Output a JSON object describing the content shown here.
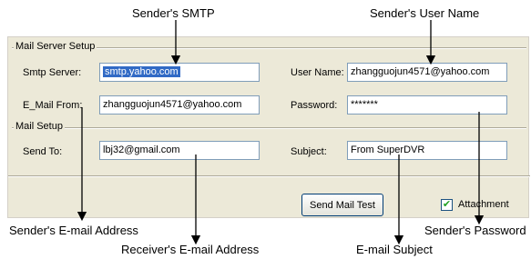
{
  "annotations": {
    "sender_smtp": "Sender's SMTP",
    "sender_user_name": "Sender's User Name",
    "sender_email_address": "Sender's E-mail Address",
    "receiver_email_address": "Receiver's E-mail  Address",
    "email_subject": "E-mail Subject",
    "sender_password": "Sender's Password"
  },
  "mail_server_setup": {
    "title": "Mail Server Setup",
    "smtp_server_label": "Smtp Server:",
    "smtp_server_value": "smtp.yahoo.com",
    "user_name_label": "User Name:",
    "user_name_value": "zhangguojun4571@yahoo.com",
    "email_from_label": "E_Mail From:",
    "email_from_value": "zhangguojun4571@yahoo.com",
    "password_label": "Password:",
    "password_value": "*******"
  },
  "mail_setup": {
    "title": "Mail Setup",
    "send_to_label": "Send To:",
    "send_to_value": "lbj32@gmail.com",
    "subject_label": "Subject:",
    "subject_value": "From SuperDVR"
  },
  "actions": {
    "send_mail_test_label": "Send Mail Test",
    "attachment_label": "Attachment",
    "attachment_checked": true
  }
}
